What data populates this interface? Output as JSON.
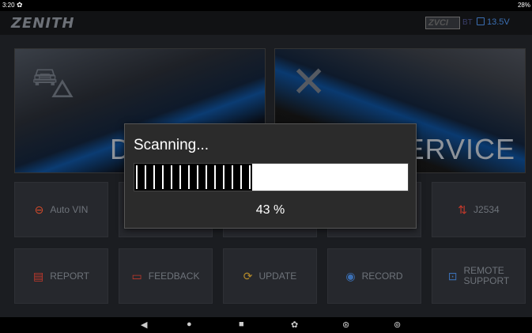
{
  "status_bar": {
    "time": "3:20",
    "battery": "28%"
  },
  "header": {
    "logo": "ZENITH",
    "device": "ZVCI",
    "bt": "BT",
    "voltage": "13.5V"
  },
  "panels": [
    {
      "label": "D",
      "icon": "car-search-icon"
    },
    {
      "label": "SERVICE",
      "icon": "tools-icon"
    }
  ],
  "tiles_row1": [
    {
      "label": "Auto VIN",
      "icon": "vin-icon"
    },
    {
      "label": ""
    },
    {
      "label": ""
    },
    {
      "label": ""
    },
    {
      "label": "J2534",
      "icon": "j2534-icon"
    }
  ],
  "tiles_row2": [
    {
      "label": "REPORT",
      "icon": "report-icon"
    },
    {
      "label": "FEEDBACK",
      "icon": "feedback-icon"
    },
    {
      "label": "UPDATE",
      "icon": "update-icon"
    },
    {
      "label": "RECORD",
      "icon": "record-icon"
    },
    {
      "label": "REMOTE\nSUPPORT",
      "icon": "remote-support-icon"
    }
  ],
  "dialog": {
    "title": "Scanning...",
    "progress": 0.43,
    "percent_label": "43 %"
  },
  "colors": {
    "accent_blue": "#3b6fb3",
    "autovin_orange": "#d04a2a",
    "j2534_red": "#c0392b"
  }
}
